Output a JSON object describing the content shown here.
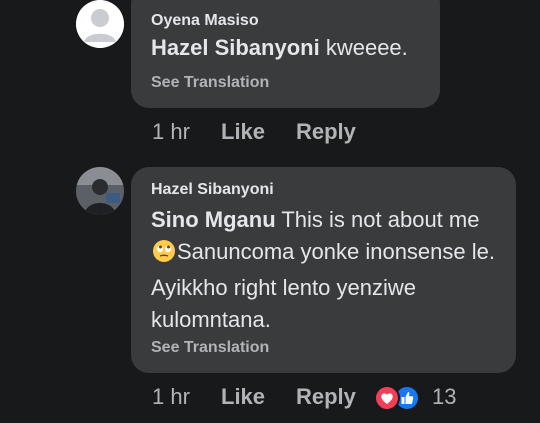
{
  "comments": [
    {
      "author": "Oyena Masiso",
      "tag": "Hazel Sibanyoni",
      "text": " kweeee.",
      "see_translation": "See Translation",
      "time": "1 hr",
      "like": "Like",
      "reply": "Reply"
    },
    {
      "author": "Hazel Sibanyoni",
      "tag": "Sino Mganu",
      "text_before_emoji": " This is not about me",
      "emoji": "face-with-rolling-eyes",
      "text_after_emoji": "Sanuncoma yonke inonsense le. Ayikkho right lento yenziwe kulomntana.",
      "see_translation": "See Translation",
      "time": "1 hr",
      "like": "Like",
      "reply": "Reply",
      "reactions": [
        "love",
        "like"
      ],
      "reaction_count": "13"
    }
  ],
  "colors": {
    "background": "#18191a",
    "bubble": "#3a3b3c",
    "primary_text": "#e4e6eb",
    "secondary_text": "#b0b3b8",
    "love": "#f33e58",
    "like": "#1877f2",
    "emoji": "#ffcc4d"
  }
}
